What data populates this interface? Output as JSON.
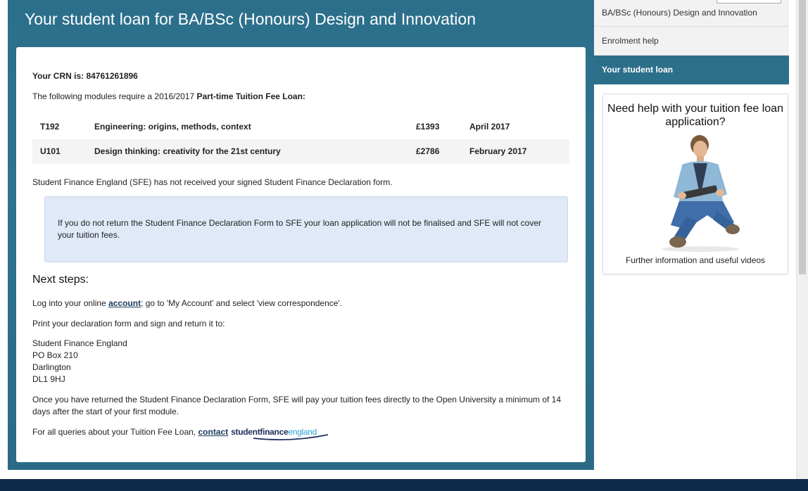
{
  "header": {
    "title": "Your student loan for BA/BSc (Honours) Design and Innovation"
  },
  "main": {
    "crn_label": "Your CRN is: 84761261896",
    "intro_prefix": "The following modules require a 2016/2017 ",
    "intro_bold": "Part-time Tuition Fee Loan:",
    "modules": [
      {
        "code": "T192",
        "title": "Engineering: origins, methods, context",
        "fee": "£1393",
        "start": "April 2017"
      },
      {
        "code": "U101",
        "title": "Design thinking: creativity for the 21st century",
        "fee": "£2786",
        "start": "February 2017"
      }
    ],
    "sfe_note": "Student Finance England (SFE) has not received your signed Student Finance Declaration form.",
    "warning": "If you do not return the Student Finance Declaration Form to SFE your loan application will not be finalised and SFE will not cover your tuition fees.",
    "next_steps_heading": "Next steps:",
    "step1_prefix": "Log into your online ",
    "step1_link": "account",
    "step1_suffix": "; go to 'My Account' and select 'view correspondence'.",
    "step2": "Print your declaration form and sign and return it to:",
    "address": [
      "Student Finance England",
      "PO Box 210",
      "Darlington",
      "DL1 9HJ"
    ],
    "pay_note": "Once you have returned the Student Finance Declaration Form, SFE will pay your tuition fees directly to the Open University a minimum of 14 days after the start of your first module.",
    "queries_prefix": "For all queries about your Tuition Fee Loan, ",
    "queries_link": "contact",
    "logo_part1": "studentfinance",
    "logo_part2": "england"
  },
  "sidebar": {
    "items": [
      {
        "label": "BA/BSc (Honours) Design and Innovation"
      },
      {
        "label": "Enrolment help"
      },
      {
        "label": "Your student loan"
      }
    ],
    "help_card": {
      "title": "Need help with your tuition fee loan application?",
      "link": "Further information and useful videos"
    }
  },
  "colors": {
    "panel_blue": "#2c6f8b",
    "warning_bg": "#dfe9f8",
    "footer_navy": "#102a4c",
    "logo_navy": "#1c2f5c",
    "logo_cyan": "#2a9fd8"
  }
}
